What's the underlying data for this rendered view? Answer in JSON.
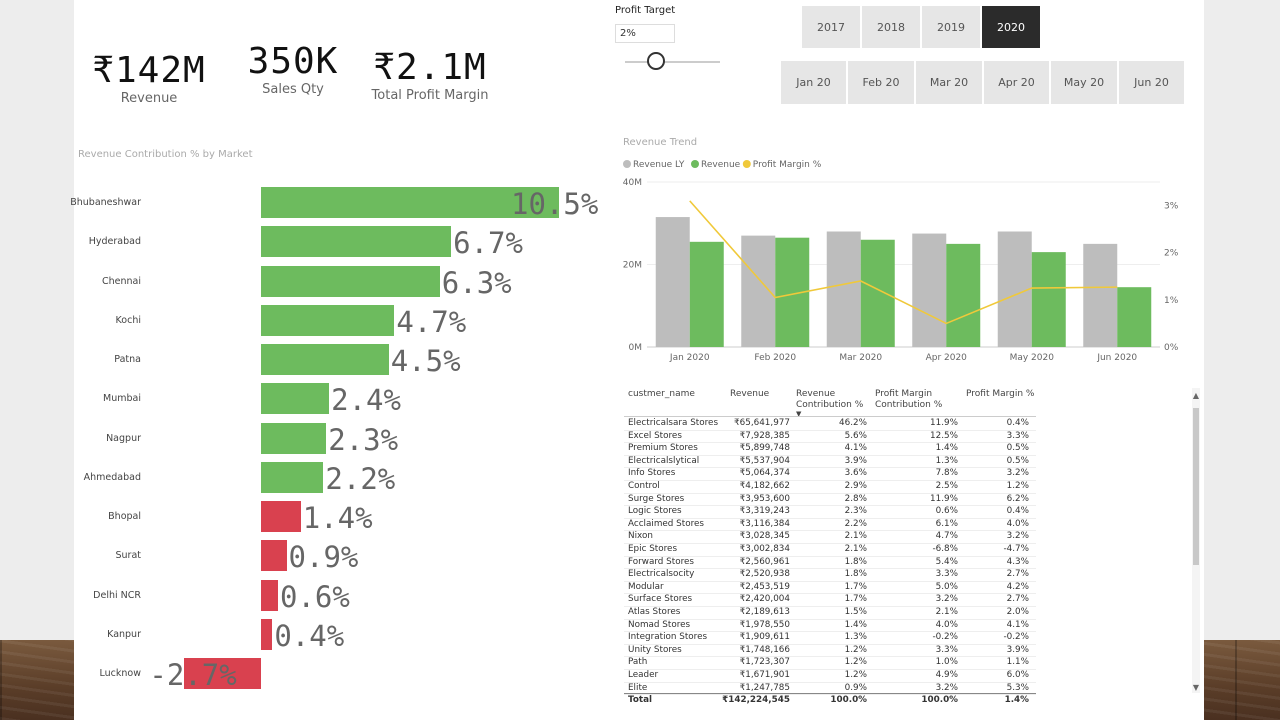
{
  "kpis": [
    {
      "value": "₹142M",
      "label": "Revenue"
    },
    {
      "value": "350K",
      "label": "Sales Qty"
    },
    {
      "value": "₹2.1M",
      "label": "Total Profit Margin"
    }
  ],
  "profit_target": {
    "label": "Profit Target",
    "value": "2%"
  },
  "years": [
    "2017",
    "2018",
    "2019",
    "2020"
  ],
  "selected_year": "2020",
  "months": [
    "Jan 20",
    "Feb 20",
    "Mar 20",
    "Apr 20",
    "May 20",
    "Jun 20"
  ],
  "colors": {
    "positive": "#6dbb5e",
    "negative": "#d9414f",
    "ly": "#bdbdbd",
    "line": "#f0c93a"
  },
  "chart_data": [
    {
      "type": "bar",
      "title": "Revenue Contribution % by Market",
      "orientation": "horizontal",
      "categories": [
        "Bhubaneshwar",
        "Hyderabad",
        "Chennai",
        "Kochi",
        "Patna",
        "Mumbai",
        "Nagpur",
        "Ahmedabad",
        "Bhopal",
        "Surat",
        "Delhi NCR",
        "Kanpur",
        "Lucknow"
      ],
      "values": [
        10.5,
        6.7,
        6.3,
        4.7,
        4.5,
        2.4,
        2.3,
        2.2,
        1.4,
        0.9,
        0.6,
        0.4,
        -2.7
      ],
      "labels": [
        "10.5%",
        "6.7%",
        "6.3%",
        "4.7%",
        "4.5%",
        "2.4%",
        "2.3%",
        "2.2%",
        "1.4%",
        "0.9%",
        "0.6%",
        "0.4%",
        "-2.7%"
      ],
      "xlim": [
        -2.7,
        10.5
      ]
    },
    {
      "type": "bar",
      "title": "Revenue Trend",
      "categories": [
        "Jan 2020",
        "Feb 2020",
        "Mar 2020",
        "Apr 2020",
        "May 2020",
        "Jun 2020"
      ],
      "series": [
        {
          "name": "Revenue LY",
          "values": [
            31.5,
            27.0,
            28.0,
            27.5,
            28.0,
            25.0
          ]
        },
        {
          "name": "Revenue",
          "values": [
            25.5,
            26.5,
            26.0,
            25.0,
            23.0,
            14.5
          ]
        },
        {
          "name": "Profit Margin %",
          "type": "line",
          "axis": "right",
          "values": [
            3.1,
            1.05,
            1.4,
            0.5,
            1.25,
            1.27
          ]
        }
      ],
      "ylim": [
        0,
        40
      ],
      "y_ticks": [
        "0M",
        "20M",
        "40M"
      ],
      "y2lim": [
        0,
        3.5
      ],
      "y2_ticks": [
        "0%",
        "1%",
        "2%",
        "3%"
      ],
      "legend": "top-left"
    },
    {
      "type": "table",
      "columns": [
        "custmer_name",
        "Revenue",
        "Revenue Contribution %",
        "Profit Margin Contribution %",
        "Profit Margin %"
      ],
      "rows": [
        [
          "Electricalsara Stores",
          "₹65,641,977",
          "46.2%",
          "11.9%",
          "0.4%"
        ],
        [
          "Excel Stores",
          "₹7,928,385",
          "5.6%",
          "12.5%",
          "3.3%"
        ],
        [
          "Premium Stores",
          "₹5,899,748",
          "4.1%",
          "1.4%",
          "0.5%"
        ],
        [
          "Electricalslytical",
          "₹5,537,904",
          "3.9%",
          "1.3%",
          "0.5%"
        ],
        [
          "Info Stores",
          "₹5,064,374",
          "3.6%",
          "7.8%",
          "3.2%"
        ],
        [
          "Control",
          "₹4,182,662",
          "2.9%",
          "2.5%",
          "1.2%"
        ],
        [
          "Surge Stores",
          "₹3,953,600",
          "2.8%",
          "11.9%",
          "6.2%"
        ],
        [
          "Logic Stores",
          "₹3,319,243",
          "2.3%",
          "0.6%",
          "0.4%"
        ],
        [
          "Acclaimed Stores",
          "₹3,116,384",
          "2.2%",
          "6.1%",
          "4.0%"
        ],
        [
          "Nixon",
          "₹3,028,345",
          "2.1%",
          "4.7%",
          "3.2%"
        ],
        [
          "Epic Stores",
          "₹3,002,834",
          "2.1%",
          "-6.8%",
          "-4.7%"
        ],
        [
          "Forward Stores",
          "₹2,560,961",
          "1.8%",
          "5.4%",
          "4.3%"
        ],
        [
          "Electricalsocity",
          "₹2,520,938",
          "1.8%",
          "3.3%",
          "2.7%"
        ],
        [
          "Modular",
          "₹2,453,519",
          "1.7%",
          "5.0%",
          "4.2%"
        ],
        [
          "Surface Stores",
          "₹2,420,004",
          "1.7%",
          "3.2%",
          "2.7%"
        ],
        [
          "Atlas Stores",
          "₹2,189,613",
          "1.5%",
          "2.1%",
          "2.0%"
        ],
        [
          "Nomad Stores",
          "₹1,978,550",
          "1.4%",
          "4.0%",
          "4.1%"
        ],
        [
          "Integration Stores",
          "₹1,909,611",
          "1.3%",
          "-0.2%",
          "-0.2%"
        ],
        [
          "Unity Stores",
          "₹1,748,166",
          "1.2%",
          "3.3%",
          "3.9%"
        ],
        [
          "Path",
          "₹1,723,307",
          "1.2%",
          "1.0%",
          "1.1%"
        ],
        [
          "Leader",
          "₹1,671,901",
          "1.2%",
          "4.9%",
          "6.0%"
        ],
        [
          "Elite",
          "₹1,247,785",
          "0.9%",
          "3.2%",
          "5.3%"
        ]
      ],
      "total": [
        "Total",
        "₹142,224,545",
        "100.0%",
        "100.0%",
        "1.4%"
      ]
    }
  ]
}
